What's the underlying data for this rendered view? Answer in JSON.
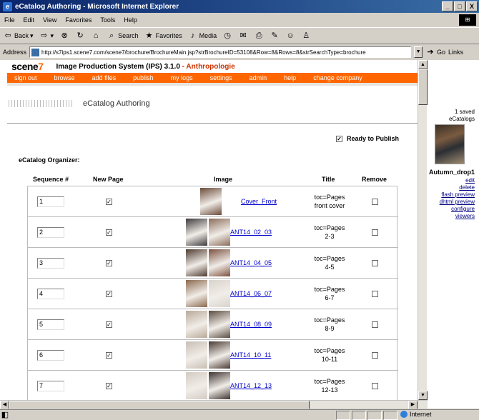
{
  "window": {
    "title": "eCatalog Authoring - Microsoft Internet Explorer",
    "controls": [
      "_",
      "□",
      "X"
    ]
  },
  "menu": [
    "File",
    "Edit",
    "View",
    "Favorites",
    "Tools",
    "Help"
  ],
  "toolbar": {
    "back": "Back",
    "search": "Search",
    "favorites": "Favorites",
    "media": "Media"
  },
  "address": {
    "label": "Address",
    "url": "http://s7ips1.scene7.com/scene7/brochure/BrochureMain.jsp?strBrochureID=53108&Row=8&Rows=8&strSearchType=brochure",
    "go": "Go",
    "links": "Links"
  },
  "app": {
    "logo_main": "scene",
    "logo_accent": "7",
    "title": "Image Production System (IPS) 3.1.0",
    "sep": " - ",
    "client": "Anthropologie",
    "nav": [
      "sign out",
      "browse",
      "add files",
      "publish",
      "my logs",
      "settings",
      "admin",
      "help",
      "change company"
    ],
    "subhead": "eCatalog Authoring",
    "ready_label": "Ready to Publish",
    "organizer_label": "eCatalog Organizer:",
    "columns": {
      "seq": "Sequence #",
      "newpage": "New Page",
      "image": "Image",
      "title": "Title",
      "remove": "Remove"
    },
    "rows": [
      {
        "seq": "1",
        "title": "Cover_Front",
        "toc1": "toc=Pages",
        "toc2": "front cover",
        "pages": 1,
        "colors": [
          "#6b4a3a"
        ]
      },
      {
        "seq": "2",
        "title": "ANT14_02_03",
        "toc1": "toc=Pages",
        "toc2": "2-3",
        "pages": 2,
        "colors": [
          "#3d3a3c",
          "#8a6c5a"
        ]
      },
      {
        "seq": "3",
        "title": "ANT14_04_05",
        "toc1": "toc=Pages",
        "toc2": "4-5",
        "pages": 2,
        "colors": [
          "#4e3b30",
          "#7c5040"
        ]
      },
      {
        "seq": "4",
        "title": "ANT14_06_07",
        "toc1": "toc=Pages",
        "toc2": "6-7",
        "pages": 2,
        "colors": [
          "#8c6a4f",
          "#d9d3cc"
        ]
      },
      {
        "seq": "5",
        "title": "ANT14_08_09",
        "toc1": "toc=Pages",
        "toc2": "8-9",
        "pages": 2,
        "colors": [
          "#b9aa9a",
          "#5b4d42"
        ]
      },
      {
        "seq": "6",
        "title": "ANT14_10_11",
        "toc1": "toc=Pages",
        "toc2": "10-11",
        "pages": 2,
        "colors": [
          "#c8bfb5",
          "#4a3a33"
        ]
      },
      {
        "seq": "7",
        "title": "ANT14_12_13",
        "toc1": "toc=Pages",
        "toc2": "12-13",
        "pages": 2,
        "colors": [
          "#d2cbc3",
          "#3e3430"
        ]
      }
    ]
  },
  "side": {
    "count_line1": "1 saved",
    "count_line2": "eCatalogs",
    "name": "Autumn_drop1",
    "links": [
      "edit",
      "delete",
      "flash preview",
      "dhtml preview",
      "configure",
      "viewers"
    ]
  },
  "status": {
    "zone": "Internet"
  },
  "colors": {
    "accent": "#ff6600",
    "client": "#cc3300",
    "link": "#0000cc"
  }
}
